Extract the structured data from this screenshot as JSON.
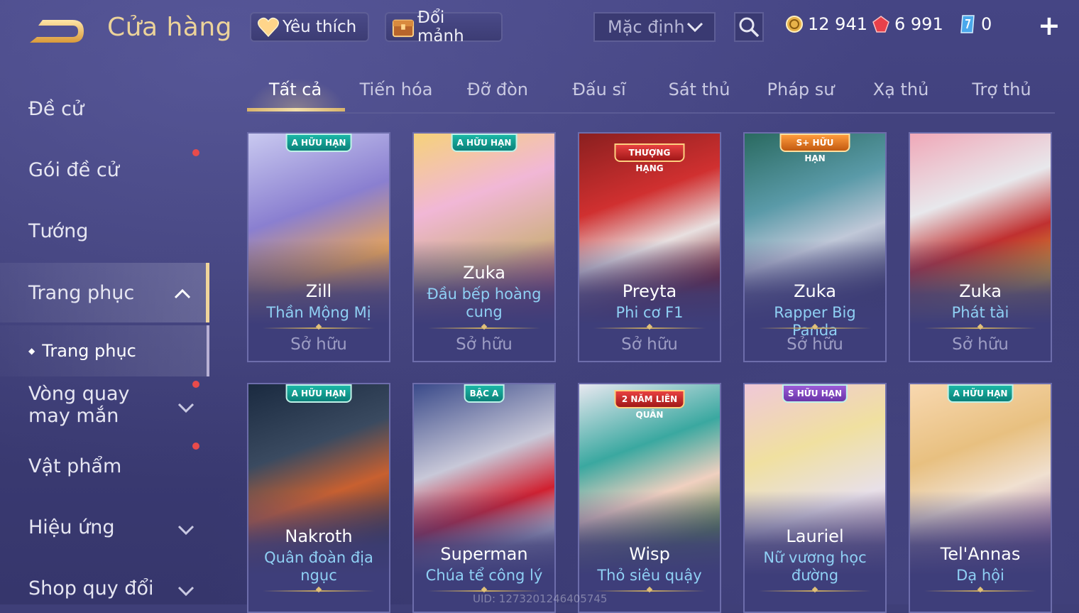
{
  "header": {
    "title": "Cửa hàng",
    "favorites_label": "Yêu thích",
    "exchange_label": "Đổi mảnh",
    "sort_value": "Mặc định"
  },
  "currencies": [
    {
      "icon": "gold-coin-icon",
      "value": "12 941"
    },
    {
      "icon": "red-gem-icon",
      "value": "6 991"
    },
    {
      "icon": "blue-voucher-icon",
      "value": "0"
    }
  ],
  "sidebar": {
    "items": [
      {
        "label": "Đề cử"
      },
      {
        "label": "Gói đề cử"
      },
      {
        "label": "Tướng"
      },
      {
        "label": "Trang phục"
      },
      {
        "label": "Vòng quay may mắn"
      },
      {
        "label": "Vật phẩm"
      },
      {
        "label": "Hiệu ứng"
      },
      {
        "label": "Shop quy đổi"
      }
    ],
    "sub_item": "Trang phục"
  },
  "tabs": [
    "Tất cả",
    "Tiến hóa",
    "Đỡ đòn",
    "Đấu sĩ",
    "Sát thủ",
    "Pháp sư",
    "Xạ thủ",
    "Trợ thủ"
  ],
  "cards": [
    {
      "hero": "Zill",
      "skin": "Thần Mộng Mị",
      "badge": "A HỮU HẠN",
      "status": "Sở hữu"
    },
    {
      "hero": "Zuka",
      "skin": "Đầu bếp hoàng cung",
      "badge": "A HỮU HẠN",
      "status": "Sở hữu"
    },
    {
      "hero": "Preyta",
      "skin": "Phi cơ F1",
      "badge": "THƯỢNG HẠNG",
      "status": "Sở hữu"
    },
    {
      "hero": "Zuka",
      "skin": "Rapper Big Panda",
      "badge": "S+ HỮU HẠN",
      "status": "Sở hữu"
    },
    {
      "hero": "Zuka",
      "skin": "Phát tài",
      "badge": "",
      "status": "Sở hữu"
    },
    {
      "hero": "Nakroth",
      "skin": "Quân đoàn địa ngục",
      "badge": "A HỮU HẠN",
      "status": ""
    },
    {
      "hero": "Superman",
      "skin": "Chúa tể công lý",
      "badge": "BẬC A",
      "status": ""
    },
    {
      "hero": "Wisp",
      "skin": "Thỏ siêu quậy",
      "badge": "2 NĂM LIÊN QUÂN",
      "status": ""
    },
    {
      "hero": "Lauriel",
      "skin": "Nữ vương học đường",
      "badge": "S HỮU HẠN",
      "status": ""
    },
    {
      "hero": "Tel'Annas",
      "skin": "Dạ hội",
      "badge": "A HỮU HẠN",
      "status": ""
    }
  ],
  "watermark": "UID: 1273201246405745",
  "colors": {
    "background": "#3f3f78",
    "title_gold": "#ecd39a",
    "skin_name": "#8fd0f4",
    "notification_dot": "#e84b4b"
  }
}
